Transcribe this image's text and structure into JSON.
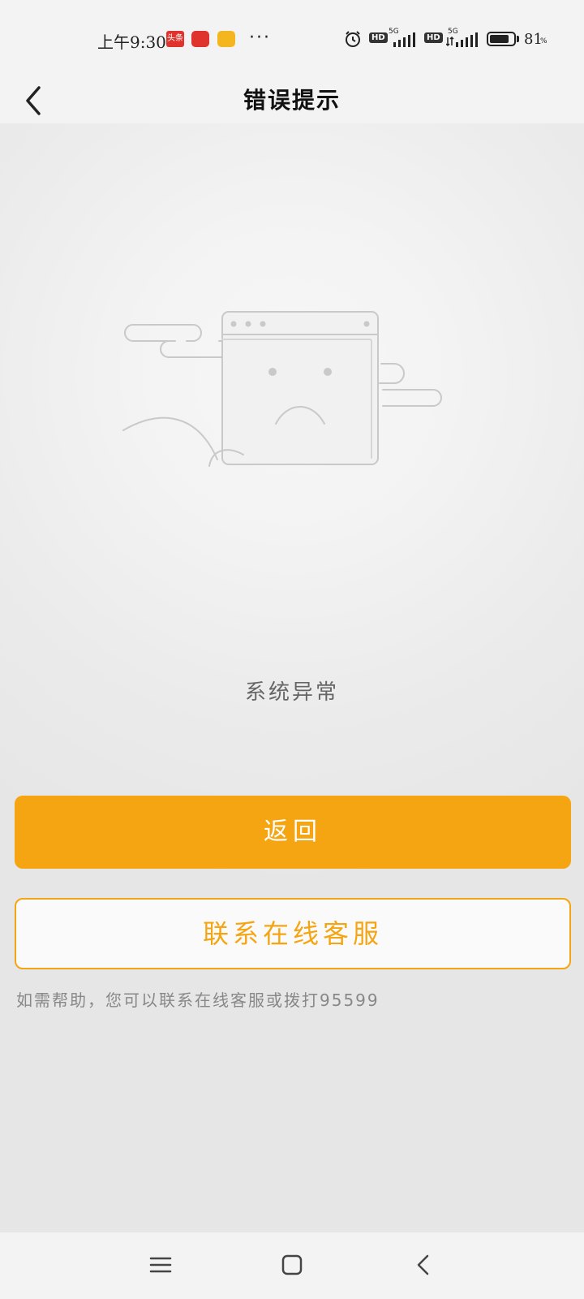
{
  "status_bar": {
    "time": "上午9:30",
    "notification_toutiao": "头条",
    "more": "···",
    "network_1": "5G",
    "network_2": "5G",
    "hd_1": "HD",
    "hd_2": "HD",
    "battery_level": 81,
    "battery_text": "81",
    "battery_unit": "%"
  },
  "nav": {
    "title": "错误提示"
  },
  "main": {
    "error_message": "系统异常",
    "back_button_label": "返回",
    "service_button_label": "联系在线客服",
    "help_text": "如需帮助，您可以联系在线客服或拨打95599"
  },
  "colors": {
    "accent": "#f5a511"
  },
  "icons": {
    "back": "chevron-left-icon",
    "illustration": "sad-browser-window-illustration",
    "nav_menu": "menu-icon",
    "nav_home": "home-square-icon",
    "nav_back": "back-triangle-icon"
  }
}
